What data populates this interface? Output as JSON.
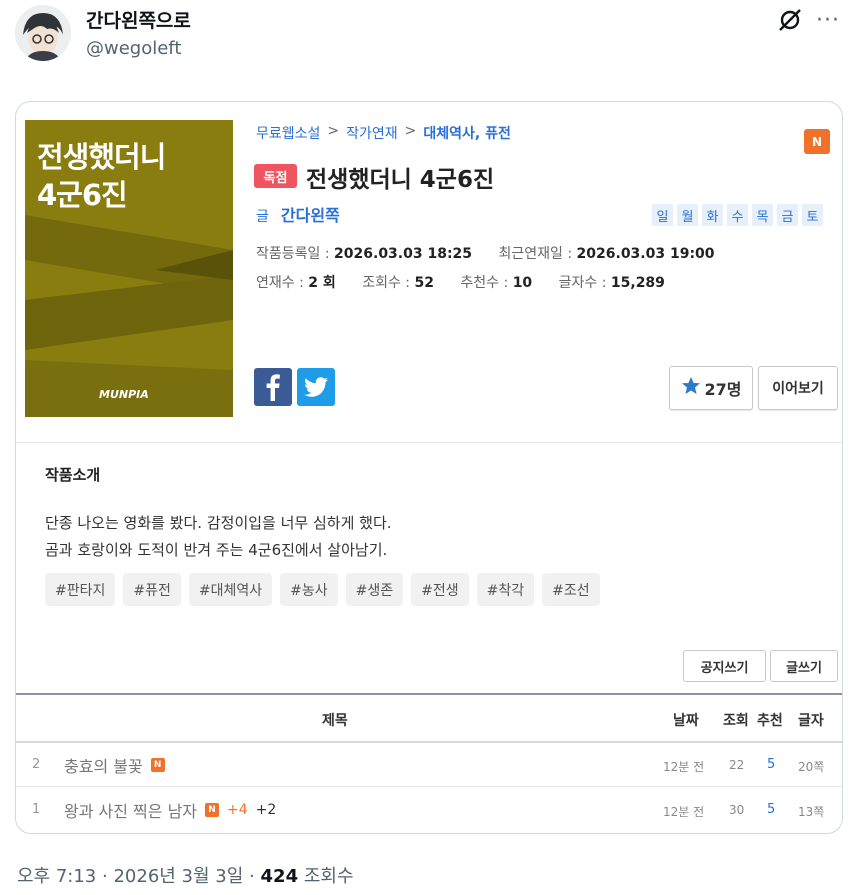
{
  "tweet": {
    "display_name": "간다왼쪽으로",
    "handle": "@wegoleft",
    "time": "오후 7:13",
    "date": "2026년 3월 3일",
    "sep": "·",
    "views_count": "424",
    "views_label": "조회수"
  },
  "card": {
    "cover": {
      "title_line1": "전생했더니",
      "title_line2": "4군6진",
      "logo": "MUNPIA",
      "color": "#8a7d10"
    },
    "breadcrumb": [
      "무료웹소설",
      "작가연재",
      "대체역사, 퓨전"
    ],
    "breadcrumb_sep": ">",
    "new_badge": "N",
    "exclusive": "독점",
    "title": "전생했더니 4군6진",
    "author_prefix": "글",
    "author": "간다왼쪽",
    "days": [
      "일",
      "월",
      "화",
      "수",
      "목",
      "금",
      "토"
    ],
    "meta1": [
      {
        "label": "작품등록일 :",
        "value": "2026.03.03 18:25"
      },
      {
        "label": "최근연재일 :",
        "value": "2026.03.03 19:00"
      }
    ],
    "meta2": [
      {
        "label": "연재수 :",
        "value": "2 회"
      },
      {
        "label": "조회수 :",
        "value": "52"
      },
      {
        "label": "추천수 :",
        "value": "10"
      },
      {
        "label": "글자수 :",
        "value": "15,289"
      }
    ],
    "favorites": "27명",
    "continue_label": "이어보기",
    "intro_heading": "작품소개",
    "intro_line1": "단종 나오는 영화를 봤다. 감정이입을 너무 심하게 했다.",
    "intro_line2": "곰과 호랑이와 도적이 반겨 주는 4군6진에서 살아남기.",
    "tags": [
      "#판타지",
      "#퓨전",
      "#대체역사",
      "#농사",
      "#생존",
      "#전생",
      "#착각",
      "#조선"
    ],
    "notice_btn": "공지쓰기",
    "write_btn": "글쓰기",
    "table": {
      "headers": {
        "title": "제목",
        "date": "날짜",
        "views": "조회",
        "recs": "추천",
        "chars": "글자"
      },
      "rows": [
        {
          "num": "2",
          "title": "충효의 불꽃",
          "badge": "N",
          "extra1": "",
          "extra2": "",
          "date": "12분 전",
          "views": "22",
          "recs": "5",
          "chars": "20쪽"
        },
        {
          "num": "1",
          "title": "왕과 사진 찍은 남자",
          "badge": "N",
          "extra1": "+4",
          "extra2": "+2",
          "date": "12분 전",
          "views": "30",
          "recs": "5",
          "chars": "13쪽"
        }
      ]
    }
  },
  "colors": {
    "link_blue": "#2a6fd6",
    "orange": "#f0722a",
    "exclusive_red": "#f05460",
    "facebook": "#3b5b96",
    "twitter": "#1e9ce8"
  }
}
